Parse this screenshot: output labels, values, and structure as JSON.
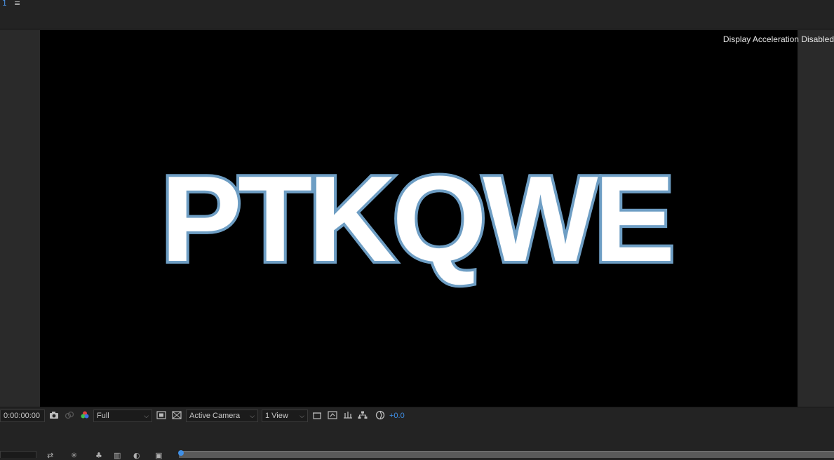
{
  "top": {
    "tab_number": "1",
    "menu_icon": "hamburger-icon"
  },
  "viewer": {
    "overlay_text": "Display Acceleration Disabled",
    "comp_text": "PTKQWE",
    "colors": {
      "text_fill": "#ffffff",
      "text_stroke": "#6e9ec4",
      "canvas": "#000000"
    }
  },
  "toolbar": {
    "timecode": "0:00:00:00",
    "resolution": "Full",
    "camera": "Active Camera",
    "views": "1 View",
    "exposure": "+0.0"
  }
}
